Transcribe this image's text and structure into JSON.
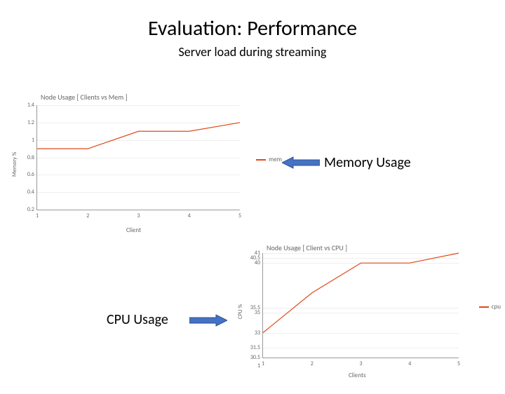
{
  "title": "Evaluation: Performance",
  "subtitle": "Server load during streaming",
  "callouts": {
    "memory": "Memory Usage",
    "cpu": "CPU Usage"
  },
  "chart_data": [
    {
      "type": "line",
      "title": "Node Usage [ Clients vs Mem ]",
      "xlabel": "Client",
      "ylabel": "Memory %",
      "legend_label": "mem",
      "x": [
        1,
        2,
        3,
        4,
        5
      ],
      "values": [
        0.9,
        0.9,
        1.1,
        1.1,
        1.2
      ],
      "yticks": [
        0.2,
        0.4,
        0.6,
        0.8,
        1,
        1.2,
        1.4
      ],
      "ylim": [
        0.2,
        1.4
      ],
      "color": "#e04a1a"
    },
    {
      "type": "line",
      "title": "Node Usage [ Client vs CPU ]",
      "xlabel": "Clients",
      "ylabel": "CPU %",
      "legend_label": "cpu",
      "x": [
        1,
        2,
        3,
        4,
        5
      ],
      "values": [
        33,
        37,
        40,
        40,
        41
      ],
      "yticks": [
        30.5,
        31.5,
        33,
        35,
        35.5,
        40,
        40.5,
        41,
        1.0
      ],
      "ylim": [
        30.5,
        41
      ],
      "color": "#e04a1a"
    }
  ]
}
